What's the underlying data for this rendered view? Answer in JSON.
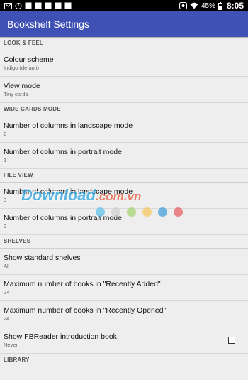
{
  "status_bar": {
    "left_icons": [
      "mail-icon",
      "alarm-icon",
      "app-icon",
      "app-icon",
      "app-icon",
      "app-icon",
      "app-icon"
    ],
    "battery": "45%",
    "time": "8:05"
  },
  "app_bar": {
    "title": "Bookshelf Settings"
  },
  "sections": [
    {
      "header": "LOOK & FEEL",
      "items": [
        {
          "title": "Colour scheme",
          "subtitle": "Indigo (default)"
        },
        {
          "title": "View mode",
          "subtitle": "Tiny cards"
        }
      ]
    },
    {
      "header": "WIDE CARDS MODE",
      "items": [
        {
          "title": "Number of columns in landscape mode",
          "subtitle": "2"
        },
        {
          "title": "Number of columns in portrait mode",
          "subtitle": "1"
        }
      ]
    },
    {
      "header": "FILE VIEW",
      "items": [
        {
          "title": "Number of columns in landscape mode",
          "subtitle": "3"
        },
        {
          "title": "Number of columns in portrait mode",
          "subtitle": "2"
        }
      ]
    },
    {
      "header": "SHELVES",
      "items": [
        {
          "title": "Show standard shelves",
          "subtitle": "All"
        },
        {
          "title": "Maximum number of books in \"Recently Added\"",
          "subtitle": "24"
        },
        {
          "title": "Maximum number of books in \"Recently Opened\"",
          "subtitle": "24"
        },
        {
          "title": "Show FBReader introduction book",
          "subtitle": "Never",
          "checkbox": false
        }
      ]
    },
    {
      "header": "LIBRARY",
      "items": []
    }
  ],
  "watermark": {
    "main": "Download",
    "ext": ".com.vn"
  },
  "colors": {
    "app_bar": "#3f51b5",
    "background": "#eeeeee",
    "dots": [
      "#5bc0eb",
      "#cfcfcf",
      "#9ed36a",
      "#f7c45b",
      "#3a9ad9",
      "#e8585b"
    ]
  }
}
